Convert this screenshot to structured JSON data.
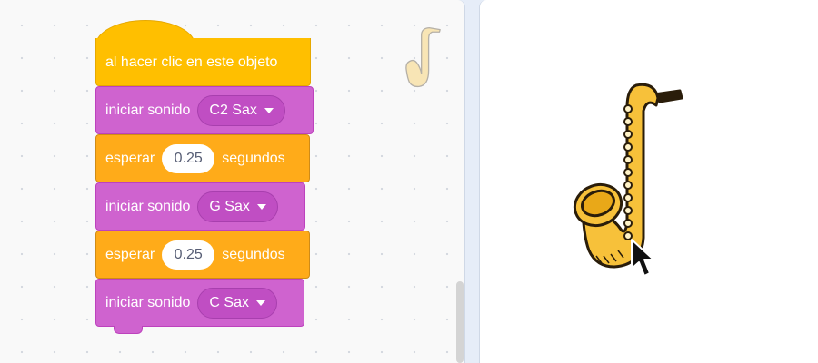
{
  "script": {
    "event_label": "al hacer clic en este objeto",
    "blocks": [
      {
        "type": "sound",
        "label": "iniciar sonido",
        "value": "C2 Sax"
      },
      {
        "type": "wait",
        "label": "esperar",
        "value": "0.25",
        "unit": "segundos"
      },
      {
        "type": "sound",
        "label": "iniciar sonido",
        "value": "G Sax"
      },
      {
        "type": "wait",
        "label": "esperar",
        "value": "0.25",
        "unit": "segundos"
      },
      {
        "type": "sound",
        "label": "iniciar sonido",
        "value": "C Sax"
      }
    ]
  },
  "icons": {
    "sprite_thumbnail": "saxophone-icon",
    "stage_sprite": "saxophone-sprite",
    "pointer": "mouse-cursor-icon",
    "dropdown": "caret-down-icon"
  },
  "colors": {
    "events": "#ffbf00",
    "sound": "#cf63cf",
    "control": "#ffab19",
    "sax_body": "#f7c13a"
  }
}
